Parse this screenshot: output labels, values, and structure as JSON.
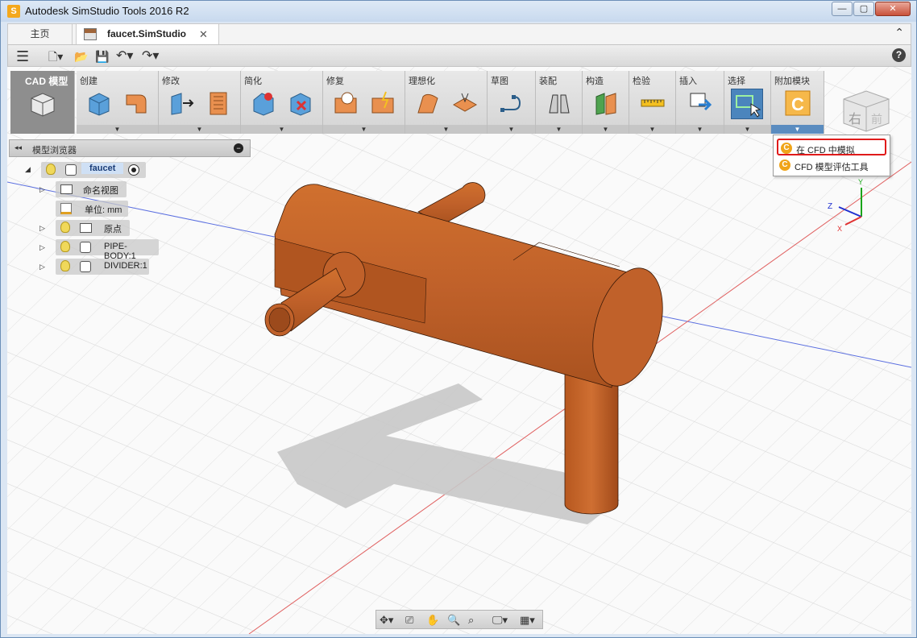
{
  "window": {
    "title": "Autodesk SimStudio Tools 2016 R2",
    "app_icon": "S",
    "min": "—",
    "max": "▢",
    "close": "✕"
  },
  "tabs": {
    "home": "主页",
    "doc": "faucet.SimStudio",
    "close": "✕",
    "collapse": "⌃"
  },
  "qat": {
    "menu": "☰",
    "new": "🗋▾",
    "open": "📂",
    "save": "💾",
    "undo": "↶▾",
    "redo": "↷▾",
    "help": "?"
  },
  "ribbon": {
    "cad_label": "CAD 模型",
    "groups": [
      "创建",
      "修改",
      "简化",
      "修复",
      "理想化",
      "草图",
      "装配",
      "构造",
      "检验",
      "插入",
      "选择",
      "附加模块"
    ],
    "dropdown_arrow": "▼"
  },
  "browser": {
    "collapse": "◂◂",
    "title": "模型浏览器",
    "minimize": "−",
    "root": "faucet",
    "nodes": [
      "命名视图",
      "单位: mm",
      "原点",
      "PIPE-BODY:1",
      "DIVIDER:1"
    ]
  },
  "addin_menu": {
    "items": [
      "在 CFD 中模拟",
      "CFD 模型评估工具"
    ]
  },
  "viewcube": {
    "face_right": "右",
    "face_back": "前"
  },
  "axes": {
    "x": "X",
    "y": "Y",
    "z": "Z"
  },
  "navbar": {
    "orbit": "✥▾",
    "look": "⎚",
    "pan": "✋",
    "zoom": "🔍",
    "fit": "⌕",
    "display": "🖵▾",
    "grid": "▦▾"
  },
  "colors": {
    "model": "#c0612a",
    "model_dark": "#9c4a1c",
    "selection_blue": "#4b85bd",
    "highlight_red": "#e01a1a"
  }
}
